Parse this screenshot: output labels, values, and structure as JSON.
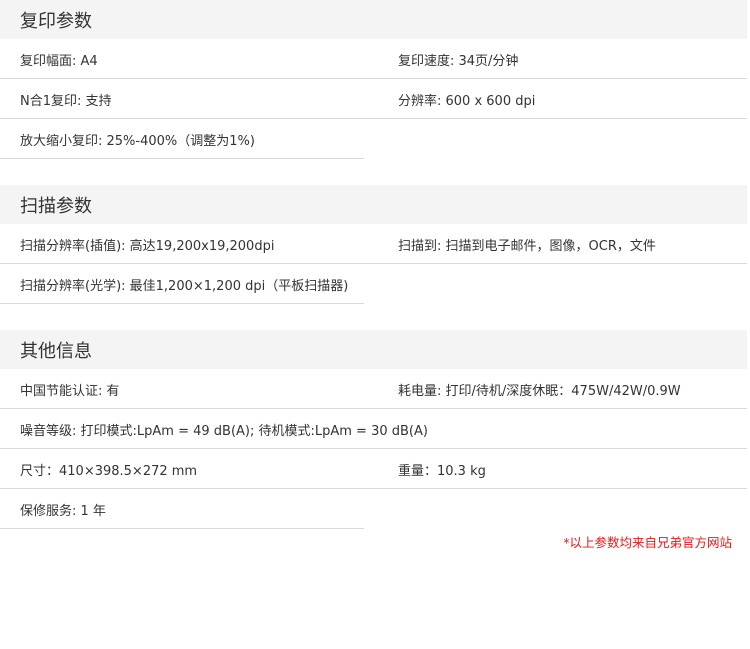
{
  "sections": [
    {
      "title": "复印参数",
      "rows": [
        {
          "left": "复印幅面: A4",
          "right": "复印速度: 34页/分钟"
        },
        {
          "left": "N合1复印: 支持",
          "right": "分辨率: 600 x 600 dpi"
        },
        {
          "left": "放大缩小复印: 25%-400%（调整为1%)",
          "right": ""
        }
      ]
    },
    {
      "title": "扫描参数",
      "rows": [
        {
          "left": "扫描分辨率(插值): 高达19,200x19,200dpi",
          "right": "扫描到: 扫描到电子邮件，图像，OCR，文件"
        },
        {
          "left": "扫描分辨率(光学): 最佳1,200×1,200 dpi（平板扫描器)",
          "right": ""
        }
      ]
    },
    {
      "title": "其他信息",
      "rows": [
        {
          "left": "中国节能认证: 有",
          "right": "耗电量: 打印/待机/深度休眠：475W/42W/0.9W"
        },
        {
          "full": "噪音等级: 打印模式:LpAm = 49 dB(A); 待机模式:LpAm = 30 dB(A)"
        },
        {
          "left": "尺寸：410×398.5×272 mm",
          "right": "重量：10.3 kg"
        },
        {
          "left": "保修服务: 1 年",
          "right": ""
        }
      ]
    }
  ],
  "footnote": "*以上参数均来自兄弟官方网站"
}
